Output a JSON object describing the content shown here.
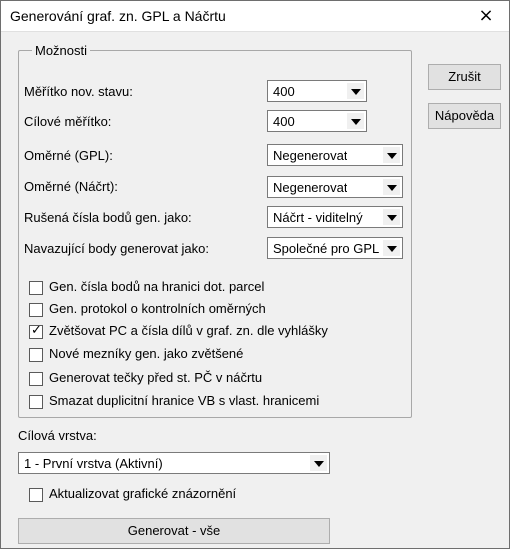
{
  "window": {
    "title": "Generování graf. zn. GPL a Náčrtu",
    "close_glyph": "×"
  },
  "options": {
    "legend": "Možnosti",
    "rows": [
      {
        "label": "Měřítko nov. stavu:",
        "value": "400"
      },
      {
        "label": "Cílové měřítko:",
        "value": "400"
      },
      {
        "label": "Oměrné (GPL):",
        "value": "Negenerovat"
      },
      {
        "label": "Oměrné (Náčrt):",
        "value": "Negenerovat"
      },
      {
        "label": "Rušená čísla bodů gen. jako:",
        "value": "Náčrt - viditelný"
      },
      {
        "label": "Navazující body generovat jako:",
        "value": "Společné pro GPL"
      }
    ],
    "checkboxes": [
      {
        "label": "Gen. čísla bodů na hranici dot. parcel",
        "checked": false
      },
      {
        "label": "Gen. protokol o kontrolních oměrných",
        "checked": false
      },
      {
        "label": "Zvětšovat PC a čísla dílů v graf. zn. dle vyhlášky",
        "checked": true
      },
      {
        "label": "Nové mezníky gen. jako zvětšené",
        "checked": false
      },
      {
        "label": "Generovat tečky před st. PČ v náčrtu",
        "checked": false
      },
      {
        "label": "Smazat duplicitní hranice VB  s vlast. hranicemi",
        "checked": false
      }
    ]
  },
  "target_layer": {
    "label": "Cílová vrstva:",
    "value": "1 - První vrstva (Aktivní)"
  },
  "update_checkbox": {
    "label": "Aktualizovat grafické znázornění",
    "checked": false
  },
  "buttons": {
    "cancel": "Zrušit",
    "help": "Nápověda",
    "generate_all": "Generovat - vše"
  }
}
